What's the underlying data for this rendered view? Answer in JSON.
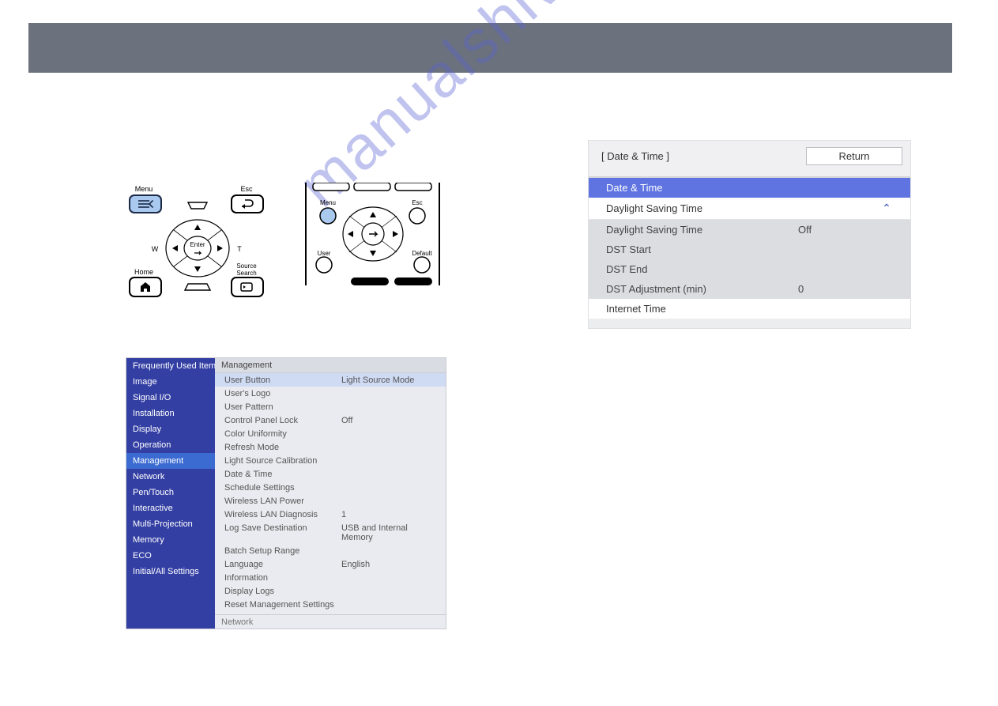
{
  "watermark": "manualshive.com",
  "panel_labels": {
    "menu": "Menu",
    "esc": "Esc",
    "w": "W",
    "t": "T",
    "enter": "Enter",
    "home": "Home",
    "source_search": "Source\nSearch"
  },
  "remote_labels": {
    "menu": "Menu",
    "esc": "Esc",
    "user": "User",
    "default": "Default"
  },
  "mgmt": {
    "sidebar": [
      {
        "label": "Frequently Used Items",
        "selected": false
      },
      {
        "label": "Image",
        "selected": false
      },
      {
        "label": "Signal I/O",
        "selected": false
      },
      {
        "label": "Installation",
        "selected": false
      },
      {
        "label": "Display",
        "selected": false
      },
      {
        "label": "Operation",
        "selected": false
      },
      {
        "label": "Management",
        "selected": true
      },
      {
        "label": "Network",
        "selected": false
      },
      {
        "label": "Pen/Touch",
        "selected": false
      },
      {
        "label": "Interactive",
        "selected": false
      },
      {
        "label": "Multi-Projection",
        "selected": false
      },
      {
        "label": "Memory",
        "selected": false
      },
      {
        "label": "ECO",
        "selected": false
      },
      {
        "label": "Initial/All Settings",
        "selected": false
      }
    ],
    "header": "Management",
    "rows": [
      {
        "label": "User Button",
        "value": "Light Source Mode",
        "highlight": true
      },
      {
        "label": "User's Logo",
        "value": ""
      },
      {
        "label": "User Pattern",
        "value": ""
      },
      {
        "label": "Control Panel Lock",
        "value": "Off"
      },
      {
        "label": "Color Uniformity",
        "value": ""
      },
      {
        "label": "Refresh Mode",
        "value": ""
      },
      {
        "label": "Light Source Calibration",
        "value": ""
      },
      {
        "label": "Date & Time",
        "value": ""
      },
      {
        "label": "Schedule Settings",
        "value": ""
      },
      {
        "label": "Wireless LAN Power",
        "value": ""
      },
      {
        "label": "Wireless LAN Diagnosis",
        "value": "1"
      },
      {
        "label": "Log Save Destination",
        "value": "USB and Internal Memory"
      },
      {
        "label": "Batch Setup Range",
        "value": ""
      },
      {
        "label": "Language",
        "value": "English"
      },
      {
        "label": "Information",
        "value": ""
      },
      {
        "label": "Display Logs",
        "value": ""
      },
      {
        "label": "Reset Management Settings",
        "value": ""
      }
    ],
    "bottom_section": "Network"
  },
  "date_time": {
    "title": "[ Date & Time ]",
    "return_label": "Return",
    "section_label": "Date & Time",
    "daylight_header": "Daylight Saving Time",
    "sub": [
      {
        "label": "Daylight Saving Time",
        "value": "Off"
      },
      {
        "label": "DST Start",
        "value": ""
      },
      {
        "label": "DST End",
        "value": ""
      },
      {
        "label": "DST Adjustment (min)",
        "value": "0"
      }
    ],
    "internet_time": "Internet Time"
  }
}
